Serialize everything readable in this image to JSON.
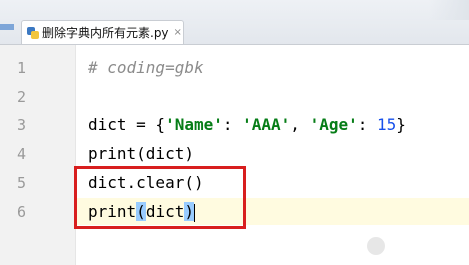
{
  "tab": {
    "label": "删除字典内所有元素.py",
    "close_glyph": "×"
  },
  "editor": {
    "line_numbers": [
      "1",
      "2",
      "3",
      "4",
      "5",
      "6"
    ],
    "lines": {
      "l1": "# coding=gbk",
      "l3_a": "dict = {",
      "l3_b": "'Name'",
      "l3_c": ": ",
      "l3_d": "'AAA'",
      "l3_e": ", ",
      "l3_f": "'Age'",
      "l3_g": ": ",
      "l3_h": "15",
      "l3_i": "}",
      "l4": "print(dict)",
      "l5": "dict.clear()",
      "l6_a": "print",
      "l6_b": "(",
      "l6_c": "dict",
      "l6_d": ")"
    }
  },
  "colors": {
    "highlight_box": "#d81e1e",
    "string": "#067d17",
    "number": "#1750eb",
    "comment": "#8c8c8c",
    "brace_match": "#99ccff"
  },
  "icons": {
    "file_icon": "python-file-icon",
    "watermark": "baidu-paw-icon"
  }
}
